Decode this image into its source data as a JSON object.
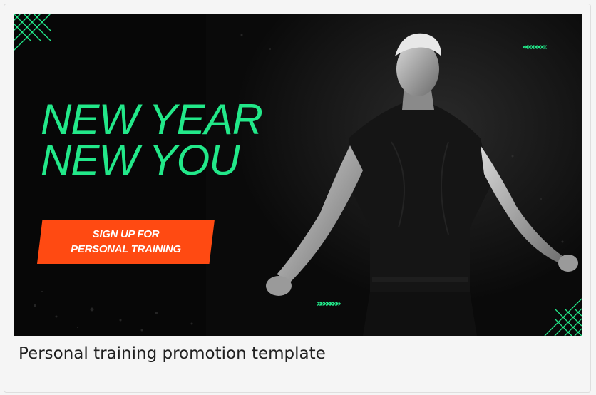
{
  "banner": {
    "headline_line1": "NEW YEAR",
    "headline_line2": "NEW YOU",
    "cta_line1": "SIGN UP FOR",
    "cta_line2": "PERSONAL TRAINING",
    "chevrons_top": "«««««««",
    "chevrons_bottom": "»»»»»»»",
    "colors": {
      "accent": "#22e889",
      "cta": "#ff4a12",
      "background": "#0b0b0b"
    }
  },
  "caption": "Personal training promotion template"
}
